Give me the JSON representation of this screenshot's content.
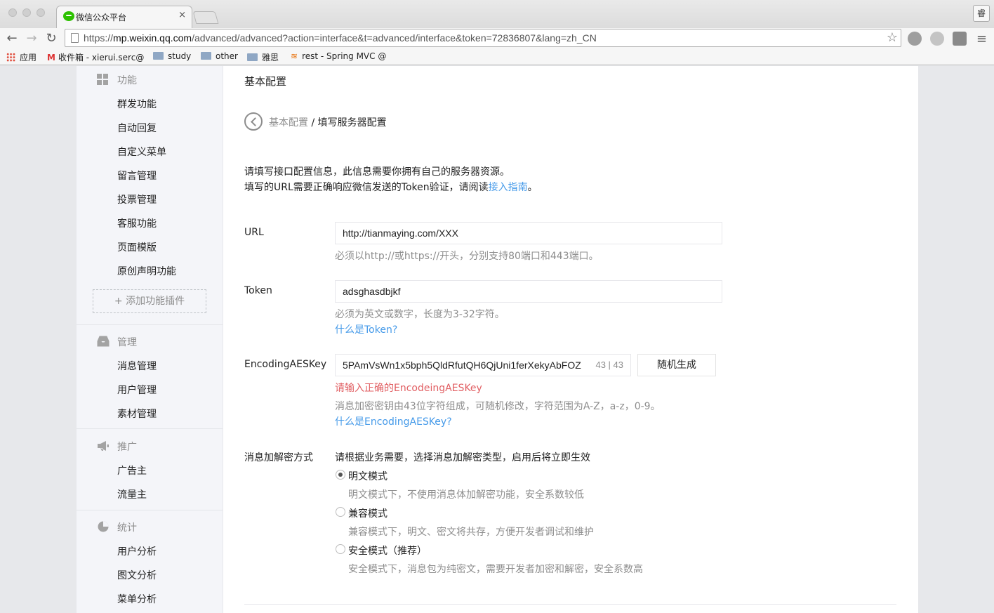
{
  "browser": {
    "tab_title": "微信公众平台",
    "tab_close": "×",
    "profile_label": "睿",
    "url_prefix": "https://",
    "url_host": "mp.weixin.qq.com",
    "url_rest": "/advanced/advanced?action=interface&t=advanced/interface&token=72836807&lang=zh_CN",
    "back_glyph": "←",
    "forward_glyph": "→",
    "reload_glyph": "↻",
    "star_glyph": "☆",
    "menu_glyph": "≡",
    "bookmarks": {
      "apps": "应用",
      "gmail": "收件箱 - xierui.serc@",
      "study": "study",
      "other": "other",
      "yasi": "雅思",
      "rest": "rest - Spring MVC @"
    }
  },
  "sidebar": {
    "groups": [
      {
        "title": "功能",
        "icon": "grid-icon",
        "items": [
          "群发功能",
          "自动回复",
          "自定义菜单",
          "留言管理",
          "投票管理",
          "客服功能",
          "页面模版",
          "原创声明功能"
        ]
      },
      {
        "title": "管理",
        "icon": "inbox-icon",
        "items": [
          "消息管理",
          "用户管理",
          "素材管理"
        ]
      },
      {
        "title": "推广",
        "icon": "megaphone-icon",
        "items": [
          "广告主",
          "流量主"
        ]
      },
      {
        "title": "统计",
        "icon": "pie-chart-icon",
        "items": [
          "用户分析",
          "图文分析",
          "菜单分析"
        ]
      }
    ],
    "add_plugin": "添加功能插件"
  },
  "main": {
    "page_title": "基本配置",
    "breadcrumb": {
      "parent": "基本配置",
      "separator": " / ",
      "current": "填写服务器配置"
    },
    "intro_line1": "请填写接口配置信息，此信息需要你拥有自己的服务器资源。",
    "intro_line2_prefix": "填写的URL需要正确响应微信发送的Token验证，请阅读",
    "intro_link": "接入指南",
    "intro_suffix": "。",
    "url_field": {
      "label": "URL",
      "value": "http://tianmaying.com/XXX",
      "tip": "必须以http://或https://开头，分别支持80端口和443端口。"
    },
    "token_field": {
      "label": "Token",
      "value": "adsghasdbjkf",
      "tip": "必须为英文或数字，长度为3-32字符。",
      "help_link": "什么是Token?"
    },
    "aes_field": {
      "label": "EncodingAESKey",
      "value": "5PAmVsWn1x5bph5QldRfutQH6QjUni1ferXekyAbFOZ",
      "counter": "43 | 43",
      "generate_button": "随机生成",
      "error": "请输入正确的EncodeingAESKey",
      "tip": "消息加密密钥由43位字符组成，可随机修改，字符范围为A-Z，a-z，0-9。",
      "help_link": "什么是EncodingAESKey?"
    },
    "encryption": {
      "label": "消息加解密方式",
      "description": "请根据业务需要，选择消息加解密类型，启用后将立即生效",
      "options": [
        {
          "label": "明文模式",
          "desc": "明文模式下，不使用消息体加解密功能，安全系数较低",
          "checked": true
        },
        {
          "label": "兼容模式",
          "desc": "兼容模式下，明文、密文将共存，方便开发者调试和维护",
          "checked": false
        },
        {
          "label": "安全模式（推荐）",
          "desc": "安全模式下，消息包为纯密文，需要开发者加密和解密，安全系数高",
          "checked": false
        }
      ]
    }
  }
}
